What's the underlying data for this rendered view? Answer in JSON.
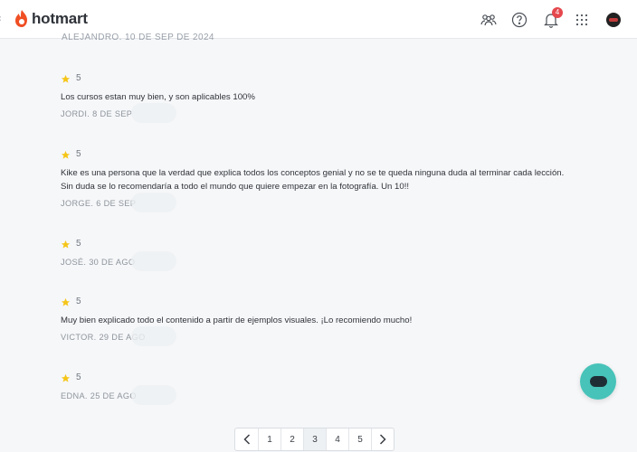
{
  "header": {
    "brand": "hotmart",
    "notification_count": "4",
    "icons": [
      "community-icon",
      "help-icon",
      "bell-icon",
      "apps-grid-icon",
      "user-avatar"
    ]
  },
  "colors": {
    "brand": "#f04e23",
    "star": "#f5c518",
    "chat": "#47c3b9",
    "background": "#f6f7f9"
  },
  "top_cutoff_text": "ALEJANDRO. 10 DE SEP DE 2024",
  "reviews": [
    {
      "rating": "5",
      "text": "Los cursos estan muy bien, y son aplicables 100%",
      "author": "JORDI. 8 DE SEP"
    },
    {
      "rating": "5",
      "text": "Kike es una persona que la verdad que explica todos los conceptos genial y no se te queda ninguna duda al terminar cada lección. Sin duda se lo recomendaría a todo el mundo que quiere empezar en la fotografía. Un 10!!",
      "author": "JORGE. 6 DE SEP"
    },
    {
      "rating": "5",
      "text": "",
      "author": "JOSÉ. 30 DE AGO"
    },
    {
      "rating": "5",
      "text": "Muy bien explicado todo el contenido a partir de ejemplos visuales. ¡Lo recomiendo mucho!",
      "author": "VICTOR. 29 DE AGO"
    },
    {
      "rating": "5",
      "text": "",
      "author": "EDNA. 25 DE AGO"
    }
  ],
  "pagination": {
    "pages": [
      "1",
      "2",
      "3",
      "4",
      "5"
    ],
    "current": "3"
  }
}
